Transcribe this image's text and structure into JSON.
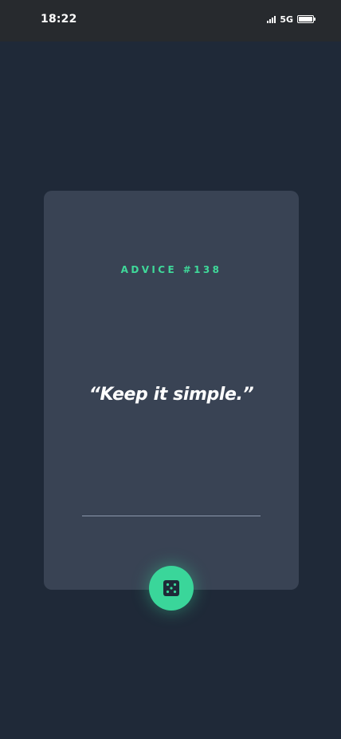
{
  "status_bar": {
    "time": "18:22",
    "network": "5G",
    "icons": [
      "signal-icon",
      "battery-icon"
    ]
  },
  "advice": {
    "label": "ADVICE #138",
    "quote": "“Keep it simple.”"
  },
  "dice_button": {
    "icon": "dice-icon"
  },
  "colors": {
    "background": "#1f2938",
    "card": "#394354",
    "accent": "#3ad69a",
    "divider": "#8c99ad",
    "text": "#ffffff"
  }
}
